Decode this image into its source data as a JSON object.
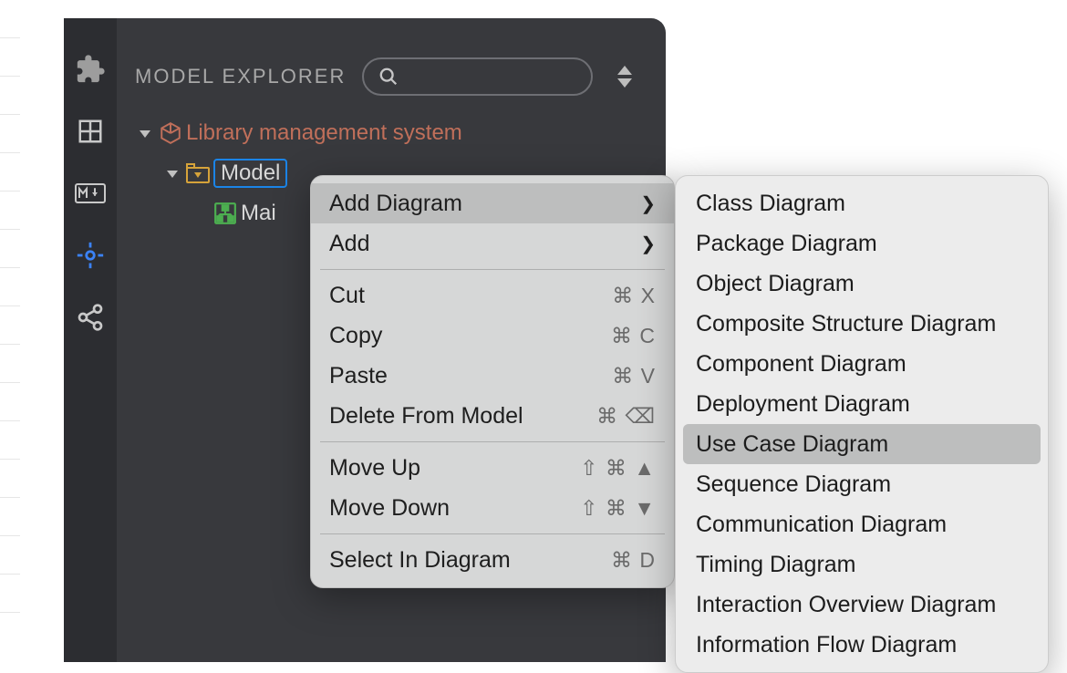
{
  "panel_title": "MODEL EXPLORER",
  "search": {
    "placeholder": ""
  },
  "tree": {
    "root_label": "Library management system",
    "model_label": "Model",
    "diagram_label": "Mai"
  },
  "context_menu": {
    "add_diagram": "Add Diagram",
    "add": "Add",
    "cut": "Cut",
    "cut_sc": "⌘ X",
    "copy": "Copy",
    "copy_sc": "⌘ C",
    "paste": "Paste",
    "paste_sc": "⌘ V",
    "delete_from_model": "Delete From Model",
    "delete_sc": "⌘ ⌫",
    "move_up": "Move Up",
    "move_up_sc": "⇧ ⌘ ▲",
    "move_down": "Move Down",
    "move_down_sc": "⇧ ⌘ ▼",
    "select_in_diagram": "Select In Diagram",
    "select_sc": "⌘ D"
  },
  "submenu": {
    "items": [
      "Class Diagram",
      "Package Diagram",
      "Object Diagram",
      "Composite Structure Diagram",
      "Component Diagram",
      "Deployment Diagram",
      "Use Case Diagram",
      "Sequence Diagram",
      "Communication Diagram",
      "Timing Diagram",
      "Interaction Overview Diagram",
      "Information Flow Diagram"
    ],
    "hover_index": 6
  }
}
